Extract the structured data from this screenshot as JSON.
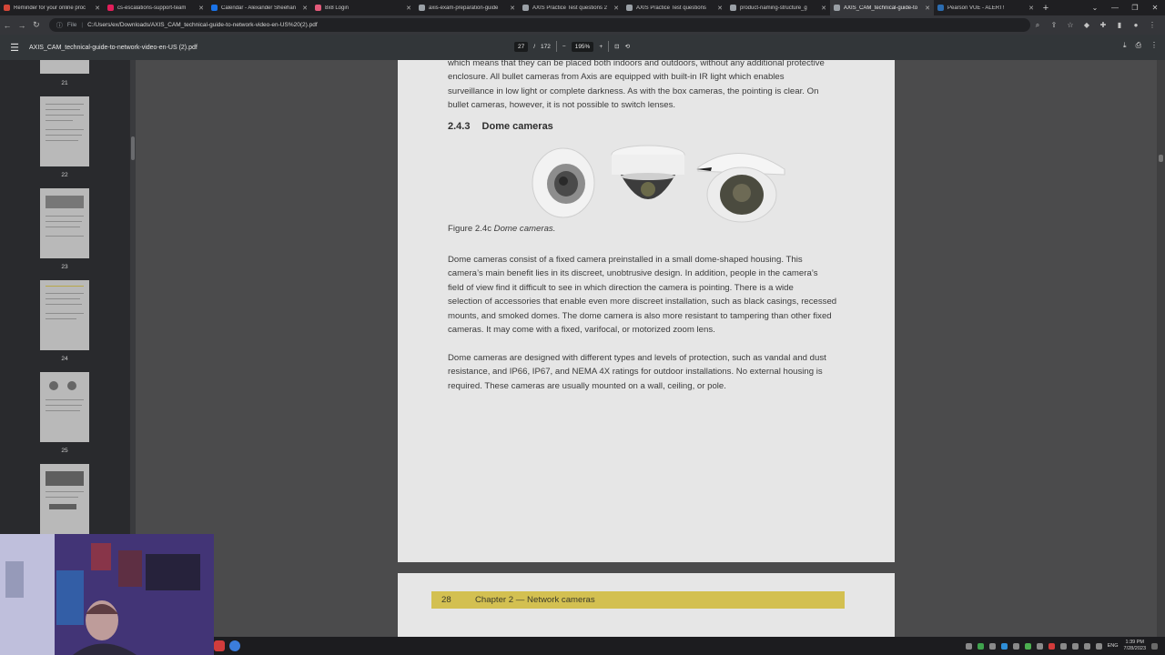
{
  "browser": {
    "tabs": [
      {
        "title": "Reminder for your online proc",
        "favicon_color": "#d44638",
        "active": false
      },
      {
        "title": "cs-escalations-support-team",
        "favicon_color": "#e01e5a",
        "active": false
      },
      {
        "title": "Calendar - Alexander Sheehan",
        "favicon_color": "#1a73e8",
        "active": false
      },
      {
        "title": "8x8 Login",
        "favicon_color": "#e25a7a",
        "active": false
      },
      {
        "title": "axis-exam-preparation-guide",
        "favicon_color": "#9aa0a6",
        "active": false
      },
      {
        "title": "AXIS Practice Test questions 2",
        "favicon_color": "#9aa0a6",
        "active": false
      },
      {
        "title": "AXIS Practice Test questions",
        "favicon_color": "#9aa0a6",
        "active": false
      },
      {
        "title": "product-naming-structure_g",
        "favicon_color": "#9aa0a6",
        "active": false
      },
      {
        "title": "AXIS_CAM_technical-guide-to",
        "favicon_color": "#9aa0a6",
        "active": true
      },
      {
        "title": "Pearson VUE - ALERT!",
        "favicon_color": "#2b6cb0",
        "active": false
      }
    ],
    "new_tab_label": "+",
    "address": {
      "scheme": "File",
      "url": "C:/Users/ex/Downloads/AXIS_CAM_technical-guide-to-network-video-en-US%20(2).pdf"
    }
  },
  "pdf_toolbar": {
    "filename": "AXIS_CAM_technical-guide-to-network-video-en-US (2).pdf",
    "current_page": "27",
    "page_separator": "/",
    "total_pages": "172",
    "zoom": "195%",
    "zoom_out": "−",
    "zoom_in": "+"
  },
  "thumbnails": [
    {
      "page": "21"
    },
    {
      "page": "22"
    },
    {
      "page": "23"
    },
    {
      "page": "24"
    },
    {
      "page": "25"
    },
    {
      "page": ""
    }
  ],
  "document": {
    "intro_lines": [
      "which means that they can be placed both indoors and outdoors, without any additional protective",
      "enclosure. All bullet cameras from Axis are equipped with built-in IR light which enables",
      "surveillance in low light or complete darkness. As with the box cameras, the pointing is clear. On",
      "bullet cameras, however, it is not possible to switch lenses."
    ],
    "section_number": "2.4.3",
    "section_title": "Dome cameras",
    "figure_label": "Figure 2.4c",
    "figure_caption": "Dome cameras.",
    "para1_lines": [
      "Dome cameras consist of a fixed camera preinstalled in a small dome-shaped housing. This",
      "camera’s main benefit lies in its discreet, unobtrusive design. In addition, people in the camera’s",
      "field of view find it difficult to see in which direction the camera is pointing. There is a wide",
      "selection of accessories that enable even more discreet installation, such as black casings, recessed",
      "mounts, and smoked domes. The dome camera is also more resistant to tampering than other fixed",
      "cameras. It may come with a fixed, varifocal, or motorized zoom lens."
    ],
    "para2_lines": [
      "Dome cameras are designed with different types and levels of protection, such as vandal and dust",
      "resistance, and IP66, IP67, and NEMA 4X ratings for outdoor installations. No external housing is",
      "required. These cameras are usually mounted on a wall, ceiling, or pole."
    ],
    "next_page_number": "28",
    "next_page_chapter": "Chapter 2 — Network cameras"
  },
  "taskbar": {
    "language": "ENG",
    "time": "1:39 PM",
    "date": "7/28/2023"
  },
  "colors": {
    "chapter_bar": "#d3c051",
    "page_bg": "#e6e6e6",
    "viewer_bg": "#4b4b4c"
  }
}
